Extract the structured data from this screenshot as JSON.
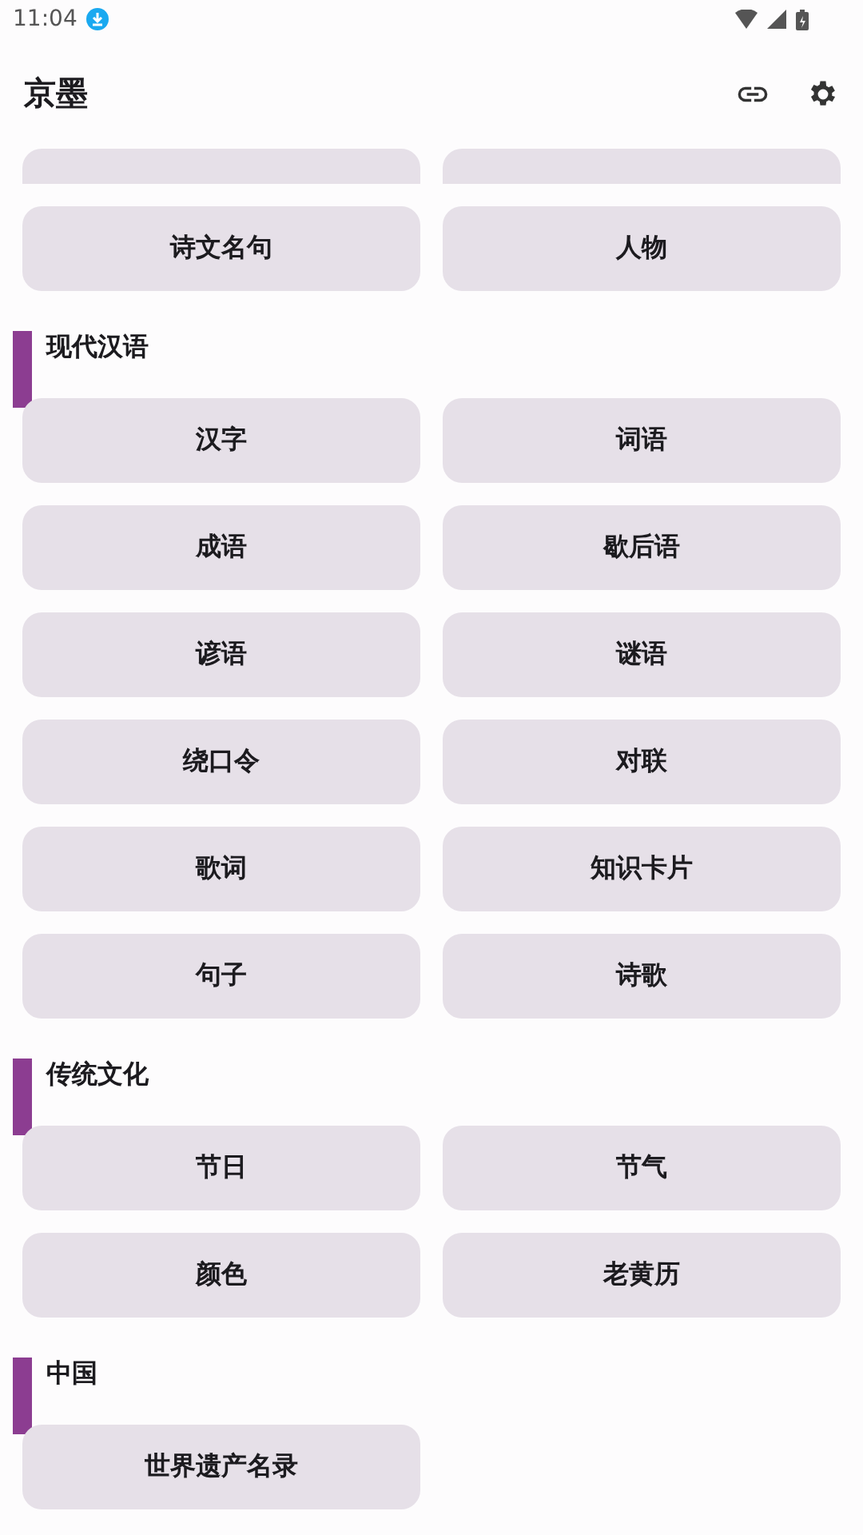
{
  "status_bar": {
    "time": "11:04"
  },
  "app_bar": {
    "title": "京墨"
  },
  "clipped_row": [
    {
      "kind": "clipped"
    },
    {
      "kind": "clipped"
    }
  ],
  "top_items": [
    {
      "label": "诗文名句"
    },
    {
      "label": "人物"
    }
  ],
  "sections": [
    {
      "title": "现代汉语",
      "items": [
        {
          "label": "汉字"
        },
        {
          "label": "词语"
        },
        {
          "label": "成语"
        },
        {
          "label": "歇后语"
        },
        {
          "label": "谚语"
        },
        {
          "label": "谜语"
        },
        {
          "label": "绕口令"
        },
        {
          "label": "对联"
        },
        {
          "label": "歌词"
        },
        {
          "label": "知识卡片"
        },
        {
          "label": "句子"
        },
        {
          "label": "诗歌"
        }
      ]
    },
    {
      "title": "传统文化",
      "items": [
        {
          "label": "节日"
        },
        {
          "label": "节气"
        },
        {
          "label": "颜色"
        },
        {
          "label": "老黄历"
        }
      ]
    },
    {
      "title": "中国",
      "items": [
        {
          "label": "世界遗产名录"
        }
      ]
    }
  ]
}
